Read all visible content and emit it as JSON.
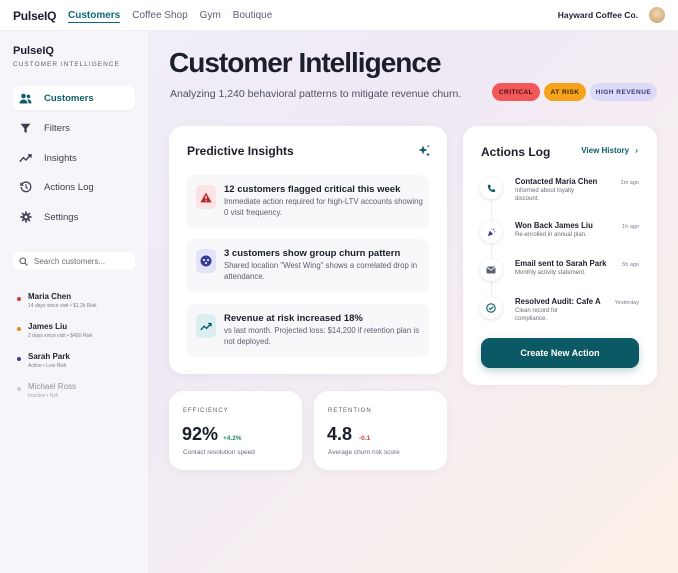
{
  "topbar": {
    "brand": "PulseIQ",
    "nav": [
      "Customers",
      "Coffee Shop",
      "Gym",
      "Boutique"
    ],
    "active_nav": "Customers",
    "org": "Hayward Coffee Co."
  },
  "sidebar": {
    "brand": "PulseIQ",
    "subtitle": "CUSTOMER INTELLIGENCE",
    "items": [
      {
        "label": "Customers",
        "icon": "users-icon"
      },
      {
        "label": "Filters",
        "icon": "filter-icon"
      },
      {
        "label": "Insights",
        "icon": "trend-icon"
      },
      {
        "label": "Actions Log",
        "icon": "history-icon"
      },
      {
        "label": "Settings",
        "icon": "gear-icon"
      }
    ],
    "search_placeholder": "Search customers...",
    "customers": [
      {
        "name": "Maria Chen",
        "meta": "14 days since visit • $1.2k Risk",
        "color": "#d93a3a"
      },
      {
        "name": "James Liu",
        "meta": "2 days since visit • $450 Risk",
        "color": "#e08a16"
      },
      {
        "name": "Sarah Park",
        "meta": "Active • Low Risk",
        "color": "#3a3c9a"
      },
      {
        "name": "Michael Ross",
        "meta": "Inactive • N/A",
        "color": "#c9cbd4"
      }
    ]
  },
  "header": {
    "title": "Customer Intelligence",
    "subtitle": "Analyzing 1,240 behavioral patterns to mitigate revenue churn.",
    "pills": [
      "CRITICAL",
      "AT RISK",
      "HIGH REVENUE"
    ]
  },
  "insights": {
    "title": "Predictive Insights",
    "rows": [
      {
        "title": "12 customers flagged critical this week",
        "desc": "Immediate action required for high-LTV accounts showing 0 visit frequency."
      },
      {
        "title": "3 customers show group churn pattern",
        "desc": "Shared location \"West Wing\" shows a correlated drop in attendance."
      },
      {
        "title": "Revenue at risk increased 18%",
        "desc": "vs last month. Projected loss: $14,200 if retention plan is not deployed."
      }
    ]
  },
  "actions": {
    "title": "Actions Log",
    "view_history": "View History",
    "rows": [
      {
        "title": "Contacted Maria Chen",
        "desc": "Informed about loyalty discount.",
        "time": "2m ago"
      },
      {
        "title": "Won Back James Liu",
        "desc": "Re-enrolled in annual plan.",
        "time": "1h ago"
      },
      {
        "title": "Email sent to Sarah Park",
        "desc": "Monthly activity statement.",
        "time": "5h ago"
      },
      {
        "title": "Resolved Audit: Cafe A",
        "desc": "Clean record for compliance.",
        "time": "Yesterday"
      }
    ],
    "cta": "Create New Action"
  },
  "metrics": {
    "efficiency": {
      "label": "EFFICIENCY",
      "value": "92%",
      "delta": "+4.2%",
      "desc": "Contact resolution speed"
    },
    "retention": {
      "label": "RETENTION",
      "value": "4.8",
      "delta": "-0.1",
      "desc": "Average churn risk score"
    }
  },
  "colors": {
    "accent": "#0c5966",
    "critical": "#f0585a",
    "at_risk": "#f6a21a",
    "high_revenue": "#dcdaf6",
    "positive": "#2a8a5a",
    "negative": "#d93a3a"
  }
}
